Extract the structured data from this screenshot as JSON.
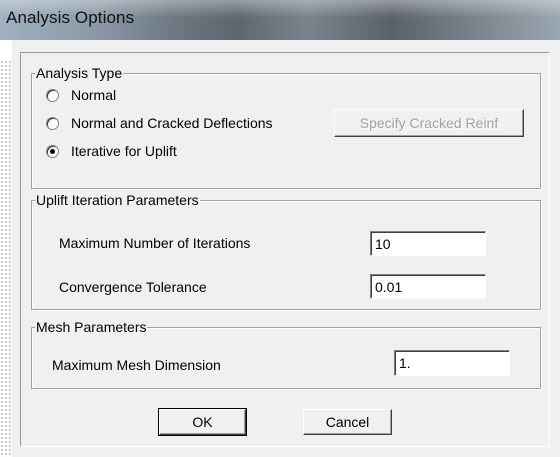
{
  "window": {
    "title": "Analysis Options"
  },
  "analysis_type": {
    "legend": "Analysis Type",
    "options": [
      {
        "label": "Normal",
        "selected": false
      },
      {
        "label": "Normal and Cracked Deflections",
        "selected": false
      },
      {
        "label": "Iterative for Uplift",
        "selected": true
      }
    ],
    "specify_button": "Specify Cracked Reinf"
  },
  "uplift": {
    "legend": "Uplift Iteration Parameters",
    "max_iterations_label": "Maximum Number of Iterations",
    "max_iterations_value": "10",
    "tolerance_label": "Convergence Tolerance",
    "tolerance_value": "0.01"
  },
  "mesh": {
    "legend": "Mesh Parameters",
    "max_dimension_label": "Maximum Mesh Dimension",
    "max_dimension_value": "1."
  },
  "buttons": {
    "ok": "OK",
    "cancel": "Cancel"
  }
}
